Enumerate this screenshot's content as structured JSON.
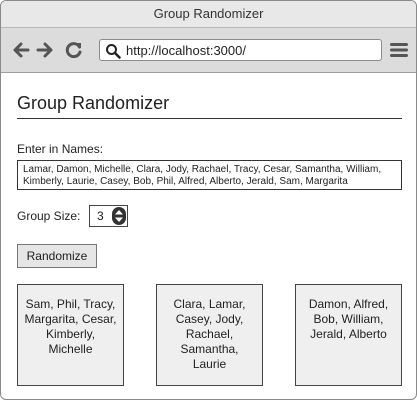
{
  "window": {
    "title": "Group Randomizer"
  },
  "browser": {
    "url": "http://localhost:3000/",
    "icons": {
      "back": "back-arrow-icon",
      "forward": "forward-arrow-icon",
      "reload": "reload-icon",
      "search": "search-icon",
      "menu": "hamburger-menu-icon"
    }
  },
  "page": {
    "title": "Group Randomizer",
    "names_label": "Enter in Names:",
    "names_value": "Lamar, Damon, Michelle, Clara, Jody, Rachael, Tracy, Cesar, Samantha, William, Kimberly, Laurie, Casey, Bob, Phil, Alfred, Alberto, Jerald, Sam, Margarita",
    "group_size_label": "Group Size:",
    "group_size_value": "3",
    "randomize_label": "Randomize",
    "groups": [
      "Sam, Phil, Tracy, Margarita, Cesar, Kimberly, Michelle",
      "Clara, Lamar, Casey, Jody, Rachael, Samantha, Laurie",
      "Damon, Alfred, Bob, William, Jerald, Alberto"
    ]
  }
}
